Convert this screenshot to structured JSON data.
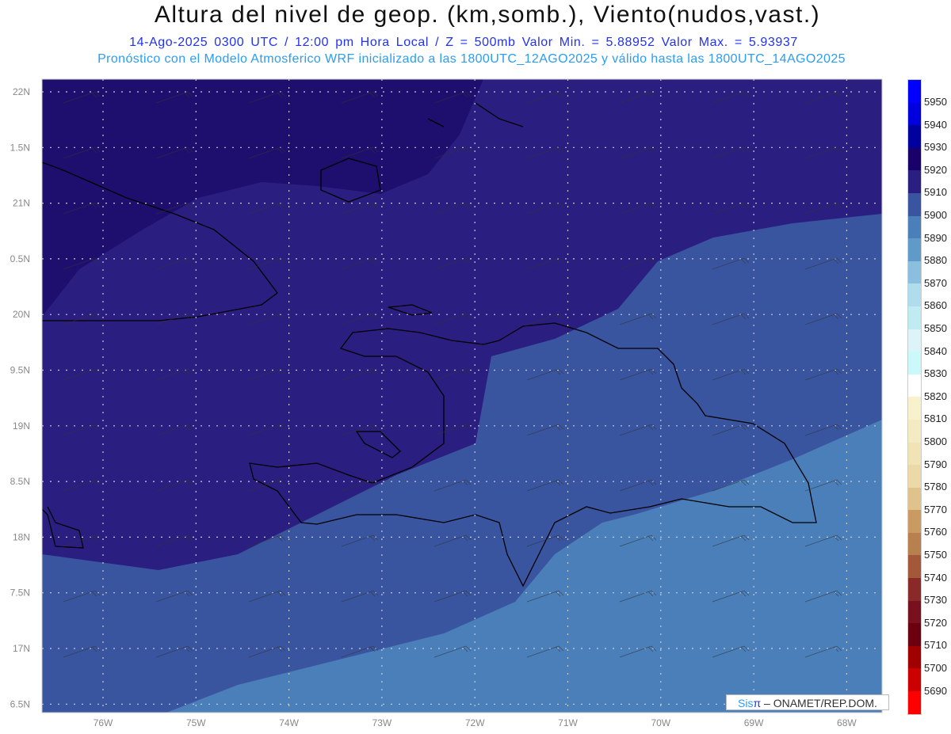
{
  "title": "Altura del nivel de geop. (km,somb.), Viento(nudos,vast.)",
  "subtitle": "14-Ago-2025  0300 UTC / 12:00 pm Hora Local / Z = 500mb   Valor Min. = 5.88952  Valor Max. = 5.93937",
  "model_line": "Pronóstico con el Modelo Atmosferico WRF inicializado a las 1800UTC_12AGO2025 y válido hasta las  1800UTC_14AGO2025",
  "lat_labels": [
    "22N",
    "1.5N",
    "21N",
    "0.5N",
    "20N",
    "9.5N",
    "19N",
    "8.5N",
    "18N",
    "7.5N",
    "17N",
    "6.5N"
  ],
  "lon_labels": [
    "76W",
    "75W",
    "74W",
    "73W",
    "72W",
    "71W",
    "70W",
    "69W",
    "68W"
  ],
  "colorbar": {
    "labels": [
      "5950",
      "5940",
      "5930",
      "5920",
      "5910",
      "5900",
      "5890",
      "5880",
      "5870",
      "5860",
      "5850",
      "5840",
      "5830",
      "5820",
      "5810",
      "5800",
      "5790",
      "5780",
      "5770",
      "5760",
      "5750",
      "5740",
      "5730",
      "5720",
      "5710",
      "5700",
      "5690"
    ],
    "colors": [
      "#0000ff",
      "#0000dd",
      "#00009e",
      "#1a006a",
      "#2a1f80",
      "#3a55a0",
      "#4a7fba",
      "#5f9ac8",
      "#8bbfe0",
      "#b0dded",
      "#c0ebf3",
      "#dcf4f8",
      "#cbf8fb",
      "#ffffff",
      "#f7f1cc",
      "#f4ebc2",
      "#f0e3b6",
      "#ebdaa8",
      "#dfc28c",
      "#c99a62",
      "#b8804f",
      "#a4583a",
      "#8a2a28",
      "#78101e",
      "#6c0010",
      "#a00000",
      "#cc0000",
      "#ff0000"
    ]
  },
  "fill_colors": {
    "c5900": "#4a7fba",
    "c5910": "#3a55a0",
    "c5920": "#2a1f80",
    "c5930": "#1e0f6e"
  },
  "credit": {
    "sis": "Sis",
    "pi": "π",
    "rest": " – ONAMET/REP.DOM."
  }
}
